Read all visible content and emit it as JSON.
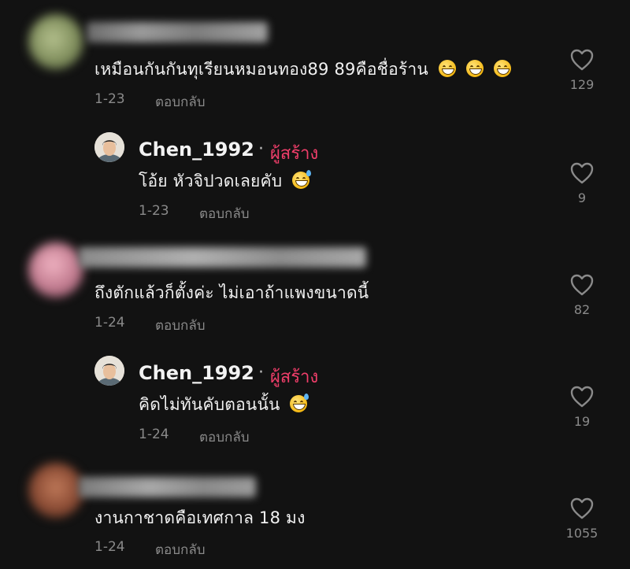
{
  "comments": [
    {
      "text": "เหมือนกันกันทุเรียนหมอนทอง89 89คือชื่อร้าน",
      "date": "1-23",
      "reply_label": "ตอบกลับ",
      "likes": "129"
    },
    {
      "author": "Chen_1992",
      "separator": "·",
      "badge": "ผู้สร้าง",
      "text": "โอ้ย หัวจิปวดเลยคับ",
      "date": "1-23",
      "reply_label": "ตอบกลับ",
      "likes": "9"
    },
    {
      "text": "ถึงตักแล้วก็ตั้งค่ะ ไม่เอาถ้าแพงขนาดนี้",
      "date": "1-24",
      "reply_label": "ตอบกลับ",
      "likes": "82"
    },
    {
      "author": "Chen_1992",
      "separator": "·",
      "badge": "ผู้สร้าง",
      "text": "คิดไม่ทันคับตอนนั้น",
      "date": "1-24",
      "reply_label": "ตอบกลับ",
      "likes": "19"
    },
    {
      "text": "งานกาชาดคือเทศกาล 18 มง",
      "date": "1-24",
      "reply_label": "ตอบกลับ",
      "likes": "1055"
    }
  ],
  "colors": {
    "background": "#121212",
    "creator_badge": "#f03e6a",
    "meta_text": "#8a8a8a"
  },
  "icons": {
    "like": "heart-outline-icon",
    "grin_emoji": "grinning-face-emoji",
    "sweat_emoji": "grinning-sweat-emoji"
  }
}
